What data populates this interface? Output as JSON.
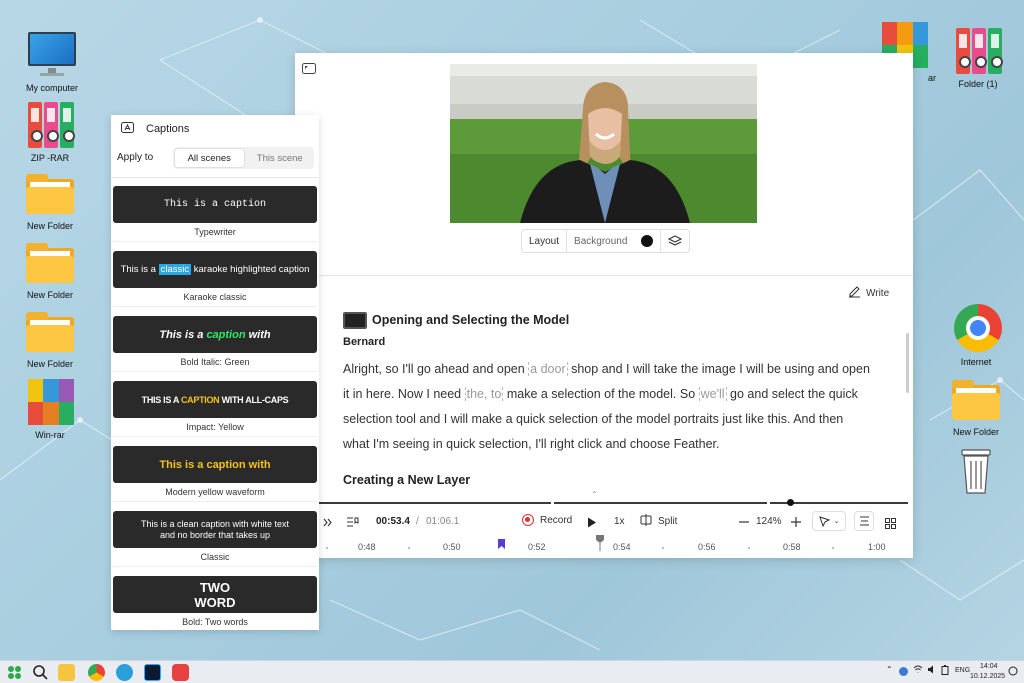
{
  "desktop": {
    "left_icons": [
      "My computer",
      "ZIP -RAR",
      "New Folder",
      "New Folder",
      "New Folder",
      "Win-rar"
    ],
    "right_icons": [
      "ar",
      "Folder (1)",
      "Internet",
      "New Folder",
      ""
    ]
  },
  "captions": {
    "title": "Captions",
    "apply_to": "Apply to",
    "scope_options": [
      "All scenes",
      "This scene"
    ],
    "selected_scope": "All scenes",
    "styles": [
      {
        "preview": "This is a caption",
        "name": "Typewriter"
      },
      {
        "preview_pre": "This is a ",
        "preview_hl": "classic",
        "preview_post": " karaoke highlighted caption",
        "name": "Karaoke classic"
      },
      {
        "preview_pre": "This is a ",
        "preview_hl": "caption",
        "preview_post": " with",
        "name": "Bold Italic: Green"
      },
      {
        "preview_pre": "THIS IS A ",
        "preview_hl": "CAPTION",
        "preview_post": " WITH ALL-CAPS",
        "name": "Impact: Yellow"
      },
      {
        "preview": "This is a caption with",
        "name": "Modern yellow waveform"
      },
      {
        "preview": "This is a clean caption with white text and no border that takes up",
        "name": "Classic"
      },
      {
        "preview": "TWO WORD",
        "name": "Bold: Two words"
      }
    ]
  },
  "editor": {
    "layout_label": "Layout",
    "background_label": "Background",
    "write_label": "Write",
    "scene_title": "Opening and Selecting the Model",
    "speaker": "Bernard",
    "transcript": {
      "p1": "Alright, so I'll go ahead and open",
      "g1": "a door",
      "p2": "shop and I will take the image I will be using and open it in here. Now I need",
      "g2": "the, to",
      "p3": "make a selection of the model. So",
      "g3": "we'll",
      "p4": "go and select the quick selection tool and I will make a quick selection of the model portraits just like this. And then what I'm seeing in quick selection, I'll right click and choose Feather."
    },
    "next_section": "Creating a New Layer",
    "controls": {
      "current_time": "00:53.4",
      "separator": "/",
      "total_time": "01:06.1",
      "record": "Record",
      "speed": "1x",
      "split": "Split",
      "zoom": "124%"
    },
    "ruler": [
      "0:48",
      "0:50",
      "0:52",
      "0:54",
      "0:56",
      "0:58",
      "1:00"
    ]
  },
  "taskbar": {
    "lang": "ENG",
    "time": "14:04",
    "date": "10.12.2025"
  },
  "colors": {
    "karaoke_hl": "#2aa6e0",
    "green_hl": "#2ee86a",
    "yellow_hl": "#f7c21b",
    "record_red": "#e03030"
  }
}
